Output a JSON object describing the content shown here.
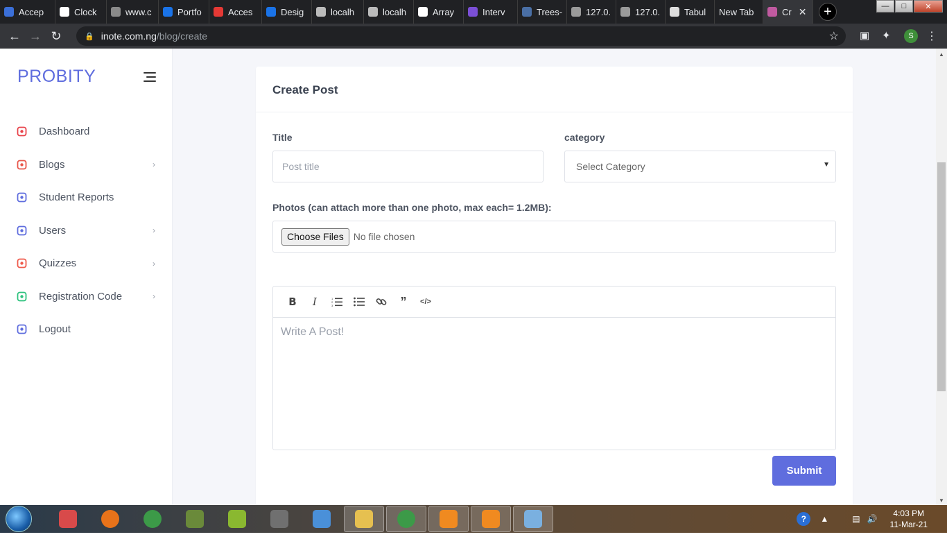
{
  "browser": {
    "tabs": [
      {
        "title": "Accep",
        "color": "#3b6fd8",
        "icon": "doc-icon"
      },
      {
        "title": "Clock",
        "color": "#ffffff",
        "icon": "video-icon"
      },
      {
        "title": "www.c",
        "color": "#8a8a8a",
        "icon": "c-icon"
      },
      {
        "title": "Portfo",
        "color": "#1a73e8",
        "icon": "c-icon"
      },
      {
        "title": "Acces",
        "color": "#e53935",
        "icon": "s-icon"
      },
      {
        "title": "Desig",
        "color": "#1a73e8",
        "icon": "c-icon"
      },
      {
        "title": "localh",
        "color": "#bbbbbb",
        "icon": "xampp-icon"
      },
      {
        "title": "localh",
        "color": "#bbbbbb",
        "icon": "x-icon"
      },
      {
        "title": "Array",
        "color": "#ffffff",
        "icon": "flag-icon"
      },
      {
        "title": "Interv",
        "color": "#7b4fd6",
        "icon": "list-icon"
      },
      {
        "title": "Trees-",
        "color": "#4a6fa5",
        "icon": "square-icon"
      },
      {
        "title": "127.0.",
        "color": "#9a9a9a",
        "icon": "globe-icon"
      },
      {
        "title": "127.0.",
        "color": "#9a9a9a",
        "icon": "globe-icon"
      },
      {
        "title": "Tabul",
        "color": "#dddddd",
        "icon": "globe-icon"
      },
      {
        "title": "New Tab",
        "color": "",
        "icon": ""
      },
      {
        "title": "Cr",
        "color": "#c05aa0",
        "icon": "probity-icon"
      }
    ],
    "url_host": "inote.com.ng",
    "url_path": "/blog/create",
    "profile_initial": "S"
  },
  "sidebar": {
    "brand": "PROBITY",
    "items": [
      {
        "label": "Dashboard",
        "icon": "compass-icon",
        "color": "#e8424a",
        "submenu": false
      },
      {
        "label": "Blogs",
        "icon": "receipt-icon",
        "color": "#e8564a",
        "submenu": true
      },
      {
        "label": "Student Reports",
        "icon": "id-card-icon",
        "color": "#5f6dde",
        "submenu": false
      },
      {
        "label": "Users",
        "icon": "user-icon",
        "color": "#5f6dde",
        "submenu": true
      },
      {
        "label": "Quizzes",
        "icon": "notes-icon",
        "color": "#ef5b4c",
        "submenu": true
      },
      {
        "label": "Registration Code",
        "icon": "key-icon",
        "color": "#2ec27e",
        "submenu": true
      },
      {
        "label": "Logout",
        "icon": "running-icon",
        "color": "#5f6dde",
        "submenu": false
      }
    ]
  },
  "form": {
    "heading": "Create Post",
    "title_label": "Title",
    "title_placeholder": "Post title",
    "category_label": "category",
    "category_selected": "Select Category",
    "photos_label": "Photos (can attach more than one photo, max each= 1.2MB):",
    "file_button": "Choose Files",
    "file_status": "No file chosen",
    "editor_placeholder": "Write A Post!",
    "toolbar": [
      "bold",
      "italic",
      "ordered-list",
      "bullet-list",
      "link",
      "quote",
      "code"
    ],
    "submit": "Submit"
  },
  "taskbar": {
    "apps": [
      {
        "name": "snipping-tool",
        "color": "#d84a4a"
      },
      {
        "name": "firefox",
        "color": "#e8731a"
      },
      {
        "name": "chrome",
        "color": "#3c9a48"
      },
      {
        "name": "calculator-app",
        "color": "#6a8a3a"
      },
      {
        "name": "chameleon-app",
        "color": "#8ab830"
      },
      {
        "name": "pine-app",
        "color": "#707070"
      },
      {
        "name": "virtualbox",
        "color": "#4a90d9"
      },
      {
        "name": "file-explorer",
        "color": "#e6c050",
        "pinned": true
      },
      {
        "name": "chrome",
        "color": "#3c9a48",
        "pinned": true
      },
      {
        "name": "sublime-text",
        "color": "#f08a20",
        "pinned": true
      },
      {
        "name": "vlc",
        "color": "#f08a20",
        "pinned": true
      },
      {
        "name": "paint",
        "color": "#7ab0e0",
        "pinned": true
      }
    ],
    "time": "4:03 PM",
    "date": "11-Mar-21"
  }
}
